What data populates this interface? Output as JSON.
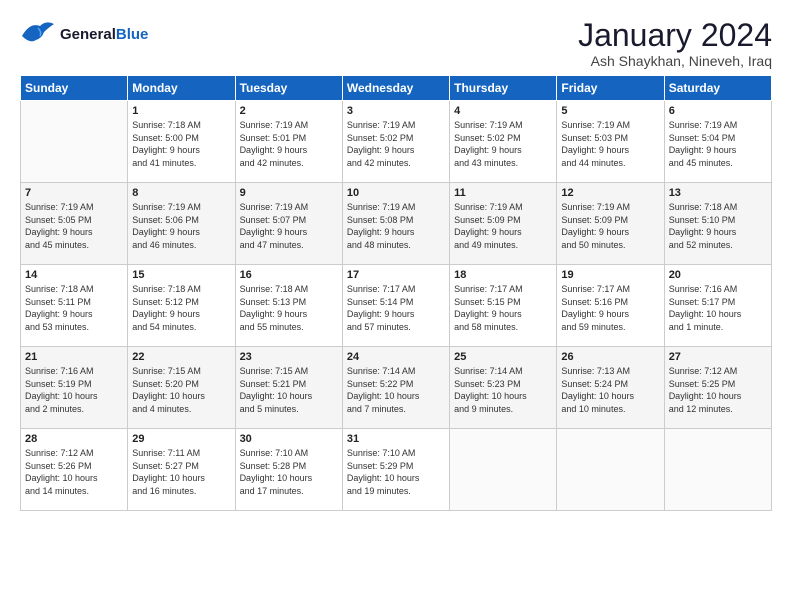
{
  "logo": {
    "general": "General",
    "blue": "Blue"
  },
  "title": "January 2024",
  "subtitle": "Ash Shaykhan, Nineveh, Iraq",
  "days_of_week": [
    "Sunday",
    "Monday",
    "Tuesday",
    "Wednesday",
    "Thursday",
    "Friday",
    "Saturday"
  ],
  "weeks": [
    [
      {
        "day": "",
        "sunrise": "",
        "sunset": "",
        "daylight": ""
      },
      {
        "day": "1",
        "sunrise": "Sunrise: 7:18 AM",
        "sunset": "Sunset: 5:00 PM",
        "daylight": "Daylight: 9 hours and 41 minutes."
      },
      {
        "day": "2",
        "sunrise": "Sunrise: 7:19 AM",
        "sunset": "Sunset: 5:01 PM",
        "daylight": "Daylight: 9 hours and 42 minutes."
      },
      {
        "day": "3",
        "sunrise": "Sunrise: 7:19 AM",
        "sunset": "Sunset: 5:02 PM",
        "daylight": "Daylight: 9 hours and 42 minutes."
      },
      {
        "day": "4",
        "sunrise": "Sunrise: 7:19 AM",
        "sunset": "Sunset: 5:02 PM",
        "daylight": "Daylight: 9 hours and 43 minutes."
      },
      {
        "day": "5",
        "sunrise": "Sunrise: 7:19 AM",
        "sunset": "Sunset: 5:03 PM",
        "daylight": "Daylight: 9 hours and 44 minutes."
      },
      {
        "day": "6",
        "sunrise": "Sunrise: 7:19 AM",
        "sunset": "Sunset: 5:04 PM",
        "daylight": "Daylight: 9 hours and 45 minutes."
      }
    ],
    [
      {
        "day": "7",
        "sunrise": "Sunrise: 7:19 AM",
        "sunset": "Sunset: 5:05 PM",
        "daylight": "Daylight: 9 hours and 45 minutes."
      },
      {
        "day": "8",
        "sunrise": "Sunrise: 7:19 AM",
        "sunset": "Sunset: 5:06 PM",
        "daylight": "Daylight: 9 hours and 46 minutes."
      },
      {
        "day": "9",
        "sunrise": "Sunrise: 7:19 AM",
        "sunset": "Sunset: 5:07 PM",
        "daylight": "Daylight: 9 hours and 47 minutes."
      },
      {
        "day": "10",
        "sunrise": "Sunrise: 7:19 AM",
        "sunset": "Sunset: 5:08 PM",
        "daylight": "Daylight: 9 hours and 48 minutes."
      },
      {
        "day": "11",
        "sunrise": "Sunrise: 7:19 AM",
        "sunset": "Sunset: 5:09 PM",
        "daylight": "Daylight: 9 hours and 49 minutes."
      },
      {
        "day": "12",
        "sunrise": "Sunrise: 7:19 AM",
        "sunset": "Sunset: 5:09 PM",
        "daylight": "Daylight: 9 hours and 50 minutes."
      },
      {
        "day": "13",
        "sunrise": "Sunrise: 7:18 AM",
        "sunset": "Sunset: 5:10 PM",
        "daylight": "Daylight: 9 hours and 52 minutes."
      }
    ],
    [
      {
        "day": "14",
        "sunrise": "Sunrise: 7:18 AM",
        "sunset": "Sunset: 5:11 PM",
        "daylight": "Daylight: 9 hours and 53 minutes."
      },
      {
        "day": "15",
        "sunrise": "Sunrise: 7:18 AM",
        "sunset": "Sunset: 5:12 PM",
        "daylight": "Daylight: 9 hours and 54 minutes."
      },
      {
        "day": "16",
        "sunrise": "Sunrise: 7:18 AM",
        "sunset": "Sunset: 5:13 PM",
        "daylight": "Daylight: 9 hours and 55 minutes."
      },
      {
        "day": "17",
        "sunrise": "Sunrise: 7:17 AM",
        "sunset": "Sunset: 5:14 PM",
        "daylight": "Daylight: 9 hours and 57 minutes."
      },
      {
        "day": "18",
        "sunrise": "Sunrise: 7:17 AM",
        "sunset": "Sunset: 5:15 PM",
        "daylight": "Daylight: 9 hours and 58 minutes."
      },
      {
        "day": "19",
        "sunrise": "Sunrise: 7:17 AM",
        "sunset": "Sunset: 5:16 PM",
        "daylight": "Daylight: 9 hours and 59 minutes."
      },
      {
        "day": "20",
        "sunrise": "Sunrise: 7:16 AM",
        "sunset": "Sunset: 5:17 PM",
        "daylight": "Daylight: 10 hours and 1 minute."
      }
    ],
    [
      {
        "day": "21",
        "sunrise": "Sunrise: 7:16 AM",
        "sunset": "Sunset: 5:19 PM",
        "daylight": "Daylight: 10 hours and 2 minutes."
      },
      {
        "day": "22",
        "sunrise": "Sunrise: 7:15 AM",
        "sunset": "Sunset: 5:20 PM",
        "daylight": "Daylight: 10 hours and 4 minutes."
      },
      {
        "day": "23",
        "sunrise": "Sunrise: 7:15 AM",
        "sunset": "Sunset: 5:21 PM",
        "daylight": "Daylight: 10 hours and 5 minutes."
      },
      {
        "day": "24",
        "sunrise": "Sunrise: 7:14 AM",
        "sunset": "Sunset: 5:22 PM",
        "daylight": "Daylight: 10 hours and 7 minutes."
      },
      {
        "day": "25",
        "sunrise": "Sunrise: 7:14 AM",
        "sunset": "Sunset: 5:23 PM",
        "daylight": "Daylight: 10 hours and 9 minutes."
      },
      {
        "day": "26",
        "sunrise": "Sunrise: 7:13 AM",
        "sunset": "Sunset: 5:24 PM",
        "daylight": "Daylight: 10 hours and 10 minutes."
      },
      {
        "day": "27",
        "sunrise": "Sunrise: 7:12 AM",
        "sunset": "Sunset: 5:25 PM",
        "daylight": "Daylight: 10 hours and 12 minutes."
      }
    ],
    [
      {
        "day": "28",
        "sunrise": "Sunrise: 7:12 AM",
        "sunset": "Sunset: 5:26 PM",
        "daylight": "Daylight: 10 hours and 14 minutes."
      },
      {
        "day": "29",
        "sunrise": "Sunrise: 7:11 AM",
        "sunset": "Sunset: 5:27 PM",
        "daylight": "Daylight: 10 hours and 16 minutes."
      },
      {
        "day": "30",
        "sunrise": "Sunrise: 7:10 AM",
        "sunset": "Sunset: 5:28 PM",
        "daylight": "Daylight: 10 hours and 17 minutes."
      },
      {
        "day": "31",
        "sunrise": "Sunrise: 7:10 AM",
        "sunset": "Sunset: 5:29 PM",
        "daylight": "Daylight: 10 hours and 19 minutes."
      },
      {
        "day": "",
        "sunrise": "",
        "sunset": "",
        "daylight": ""
      },
      {
        "day": "",
        "sunrise": "",
        "sunset": "",
        "daylight": ""
      },
      {
        "day": "",
        "sunrise": "",
        "sunset": "",
        "daylight": ""
      }
    ]
  ]
}
